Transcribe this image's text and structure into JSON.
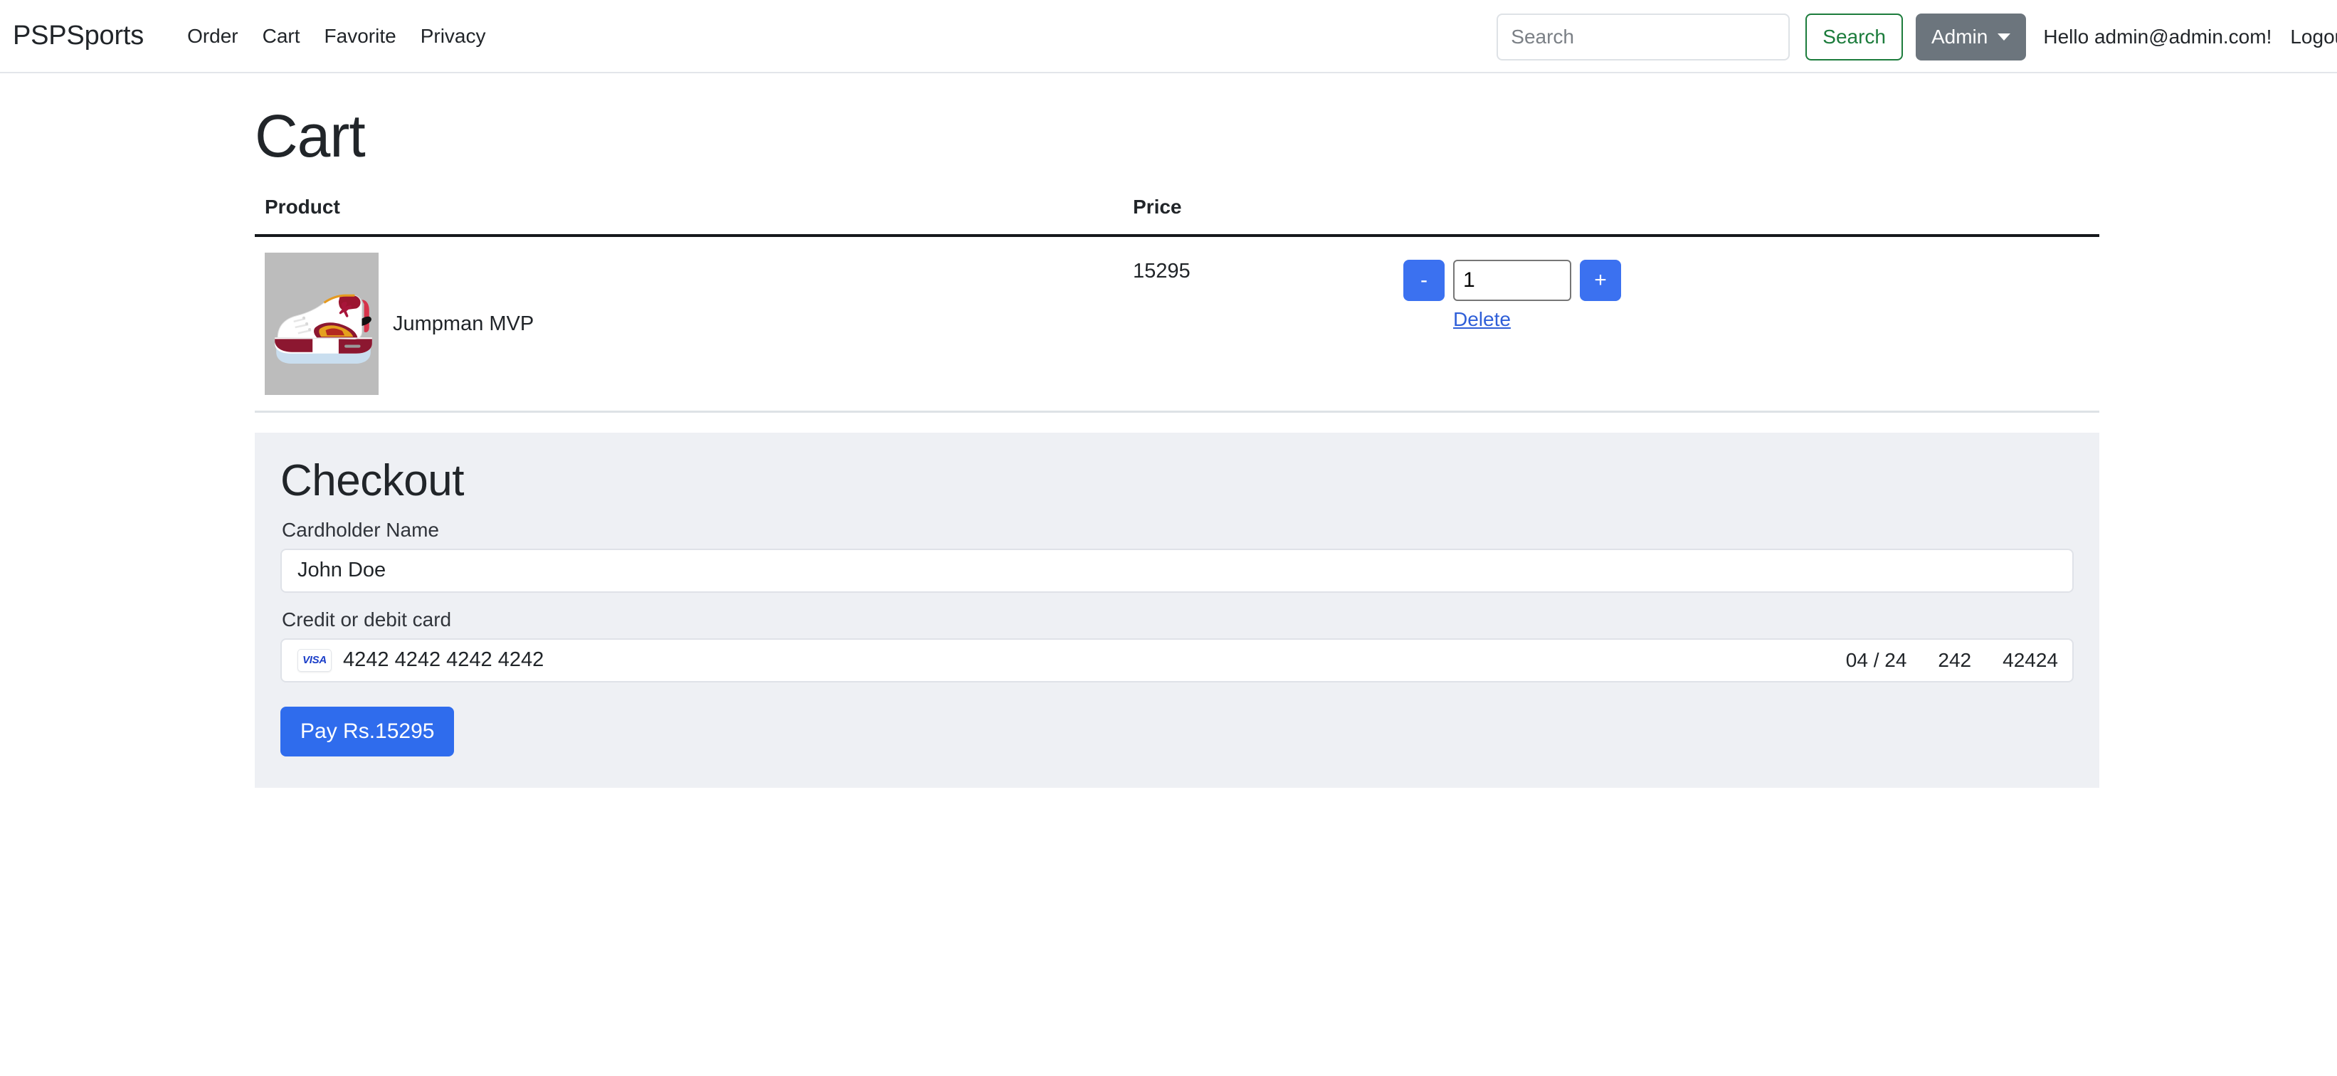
{
  "navbar": {
    "brand": "PSPSports",
    "links": [
      {
        "label": "Order"
      },
      {
        "label": "Cart"
      },
      {
        "label": "Favorite"
      },
      {
        "label": "Privacy"
      }
    ],
    "search": {
      "value": "",
      "placeholder": "Search",
      "button_label": "Search"
    },
    "admin_label": "Admin",
    "greeting": "Hello admin@admin.com!",
    "logout_label": "Logout"
  },
  "page": {
    "title": "Cart"
  },
  "cart": {
    "columns": {
      "product": "Product",
      "price": "Price",
      "quantity": ""
    },
    "rows": [
      {
        "name": "Jumpman MVP",
        "price": "15295",
        "quantity": "1",
        "decrement_label": "-",
        "increment_label": "+",
        "delete_label": "Delete"
      }
    ]
  },
  "checkout": {
    "title": "Checkout",
    "cardholder_label": "Cardholder Name",
    "cardholder_value": "John Doe",
    "card_label": "Credit or debit card",
    "card_brand": "VISA",
    "card_number": "4242 4242 4242 4242",
    "card_expiry": "04 / 24",
    "card_cvc": "242",
    "card_zip": "42424",
    "pay_label": "Pay Rs.15295"
  },
  "colors": {
    "primary_blue": "#2f6ced",
    "qty_blue": "#3b71f0",
    "success_green": "#1c7c3c",
    "secondary_gray": "#6c757d",
    "panel_bg": "#eef0f4",
    "link_blue": "#2f5fd8"
  }
}
